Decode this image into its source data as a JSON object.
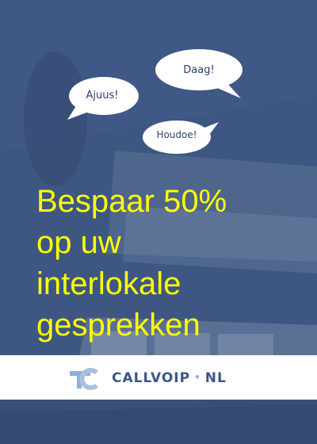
{
  "speech_bubbles": {
    "daag": "Daag!",
    "ajuus": "Ajuus!",
    "houdoe": "Houdoe!"
  },
  "headline": {
    "line1": "Bespaar 50%",
    "line2": "op uw",
    "line3": "interlokale",
    "line4": "gesprekken"
  },
  "logo": {
    "name": "CALLVOIP",
    "suffix": "NL",
    "separator": "•",
    "mark_icon": "tc-monogram-icon"
  },
  "colors": {
    "background": "#3d5782",
    "headline": "#ffff00",
    "logo_bar": "#ffffff",
    "logo_text": "#3d5782",
    "logo_accent": "#8fb0d8",
    "bubble_fill": "#ffffff"
  }
}
